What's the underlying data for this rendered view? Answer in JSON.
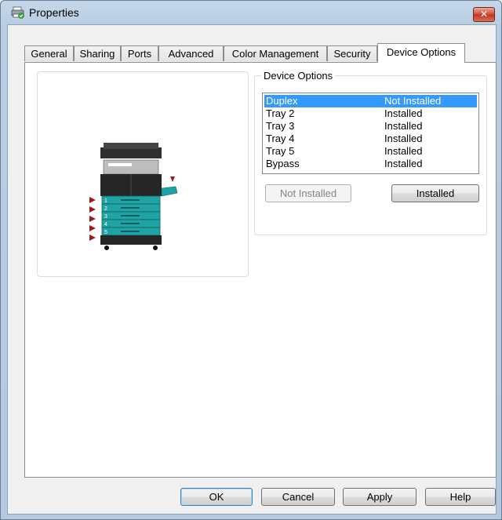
{
  "window": {
    "title": "Properties",
    "close_label": "✕"
  },
  "tabs": [
    "General",
    "Sharing",
    "Ports",
    "Advanced",
    "Color Management",
    "Security",
    "Device Options"
  ],
  "active_tab": "Device Options",
  "device_options": {
    "group_label": "Device Options",
    "rows": [
      {
        "name": "Duplex",
        "status": "Not Installed",
        "selected": true
      },
      {
        "name": "Tray 2",
        "status": "Installed"
      },
      {
        "name": "Tray 3",
        "status": "Installed"
      },
      {
        "name": "Tray 4",
        "status": "Installed"
      },
      {
        "name": "Tray 5",
        "status": "Installed"
      },
      {
        "name": "Bypass",
        "status": "Installed"
      }
    ],
    "not_installed_button": "Not Installed",
    "installed_button": "Installed"
  },
  "printer_image": {
    "tray_labels": [
      "1",
      "2",
      "3",
      "4",
      "5"
    ]
  },
  "footer": {
    "ok": "OK",
    "cancel": "Cancel",
    "apply": "Apply",
    "help": "Help"
  },
  "colors": {
    "selection": "#3399ff",
    "tray_teal": "#1fa3a5",
    "arrow_red": "#9b1b1b"
  }
}
